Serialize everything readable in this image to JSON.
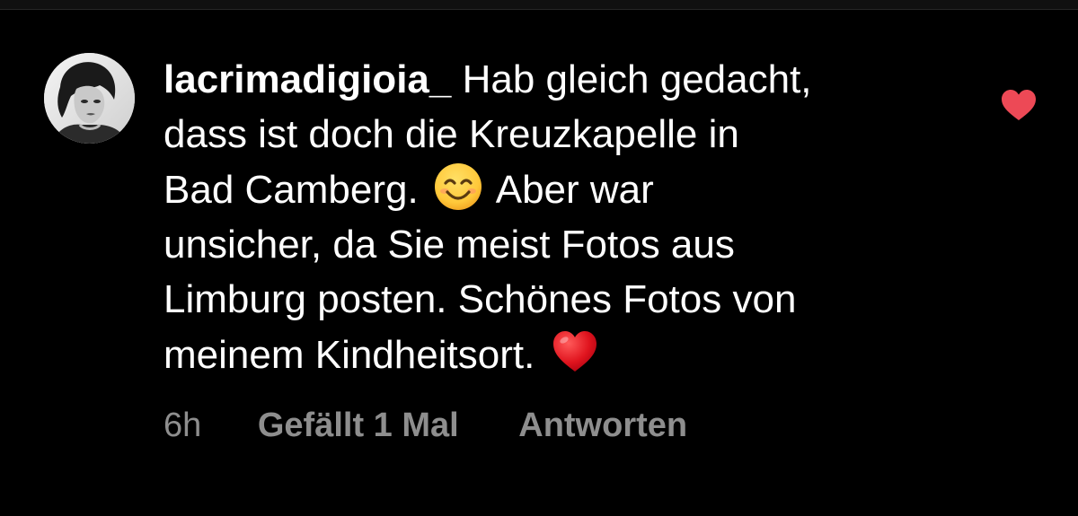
{
  "comment": {
    "username": "lacrimadigioia_",
    "text_part1": "Hab gleich gedacht,\ndass ist doch die Kreuzkapelle in\nBad Camberg.",
    "text_part2": "Aber war\nunsicher, da Sie meist Fotos aus\nLimburg posten. Schönes Fotos von\nmeinem Kindheitsort.",
    "emoji_1": "smiling-face-emoji",
    "emoji_2": "red-heart-emoji",
    "time": "6h",
    "likes_label": "Gefällt 1 Mal",
    "reply_label": "Antworten",
    "liked": true
  },
  "colors": {
    "background": "#000000",
    "text": "#ffffff",
    "meta_text": "#8e8e8e",
    "like_heart": "#ed4956"
  },
  "icons": {
    "like": "heart-icon",
    "avatar": "user-avatar"
  }
}
